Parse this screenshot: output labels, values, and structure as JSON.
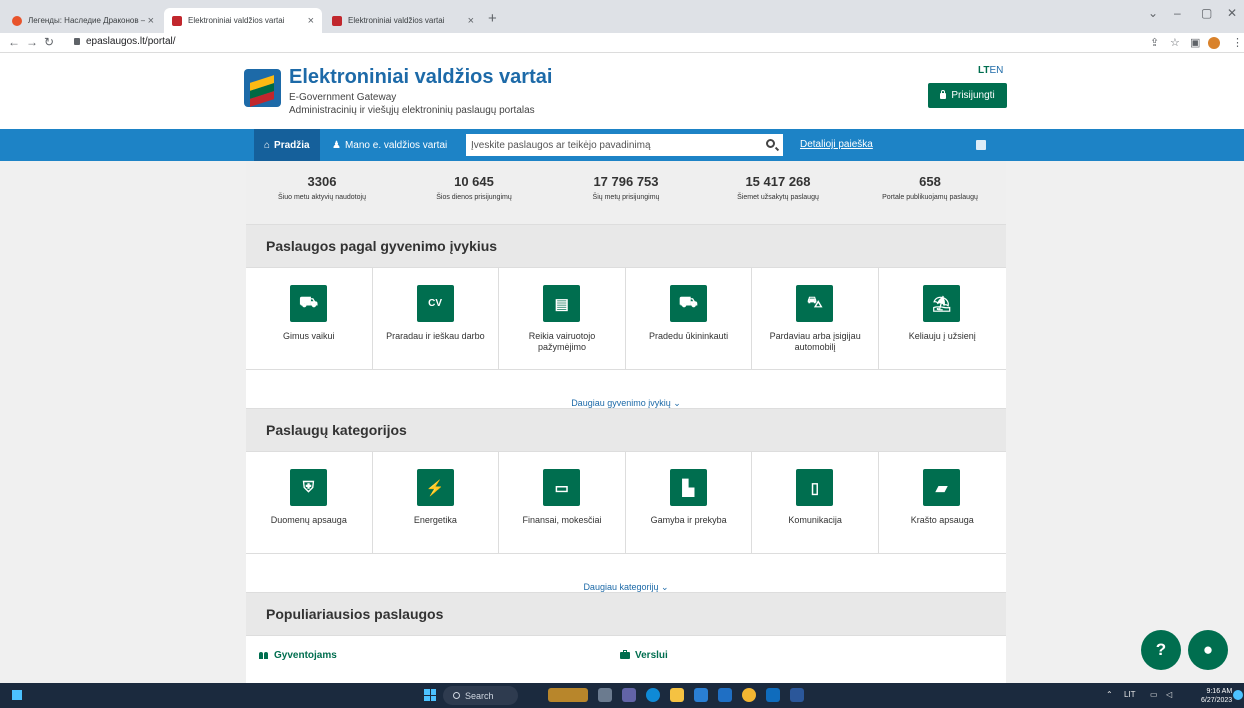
{
  "browser": {
    "tabs": [
      {
        "label": "Легенды: Наследие Драконов – ",
        "active": false,
        "favicon_color": "#e8532b"
      },
      {
        "label": "Elektroniniai valdžios vartai",
        "active": true,
        "favicon_color": "#c1272d"
      },
      {
        "label": "Elektroniniai valdžios vartai",
        "active": false,
        "favicon_color": "#c1272d"
      }
    ],
    "tab_close_glyph": "×",
    "new_tab_glyph": "+",
    "url": "epaslaugos.lt/portal/"
  },
  "header": {
    "title": "Elektroniniai valdžios vartai",
    "subtitle": "E-Government Gateway",
    "tagline": "Administracinių ir viešųjų elektroninių paslaugų portalas",
    "lang_lt": "LT",
    "lang_en": "EN",
    "login_label": "Prisijungti"
  },
  "nav": {
    "home_label": "Pradžia",
    "mano_label": "Mano e. valdžios vartai",
    "search_placeholder": "Įveskite paslaugos ar teikėjo pavadinimą",
    "detail_search_label": "Detalioji paieška"
  },
  "stats": [
    {
      "value": "3306",
      "label": "Šiuo metu aktyvių naudotojų"
    },
    {
      "value": "10 645",
      "label": "Šios dienos prisijungimų"
    },
    {
      "value": "17 796 753",
      "label": "Šių metų prisijungimų"
    },
    {
      "value": "15 417 268",
      "label": "Šiemet užsakytų paslaugų"
    },
    {
      "value": "658",
      "label": "Portale publikuojamų paslaugų"
    }
  ],
  "life_events": {
    "heading": "Paslaugos pagal gyvenimo įvykius",
    "items": [
      {
        "label": "Gimus vaikui",
        "icon": "stroller-icon",
        "glyph": "⛟"
      },
      {
        "label": "Praradau ir ieškau darbo",
        "icon": "cv-icon",
        "glyph": "CV"
      },
      {
        "label": "Reikia vairuotojo pažymėjimo",
        "icon": "license-icon",
        "glyph": "▤"
      },
      {
        "label": "Pradedu ūkininkauti",
        "icon": "tractor-icon",
        "glyph": "⛟"
      },
      {
        "label": "Pardaviau arba įsigijau automobilį",
        "icon": "car-icon",
        "glyph": "⛍"
      },
      {
        "label": "Keliauju į užsienį",
        "icon": "palm-icon",
        "glyph": "⛱"
      }
    ],
    "more_label": "Daugiau gyvenimo įvykių"
  },
  "categories": {
    "heading": "Paslaugų kategorijos",
    "items": [
      {
        "label": "Duomenų apsauga",
        "icon": "shield-icon",
        "glyph": "⛨"
      },
      {
        "label": "Energetika",
        "icon": "battery-icon",
        "glyph": "⚡"
      },
      {
        "label": "Finansai, mokesčiai",
        "icon": "banknote-icon",
        "glyph": "▭"
      },
      {
        "label": "Gamyba ir prekyba",
        "icon": "factory-icon",
        "glyph": "▙"
      },
      {
        "label": "Komunikacija",
        "icon": "phone-icon",
        "glyph": "▯"
      },
      {
        "label": "Krašto apsauga",
        "icon": "tank-icon",
        "glyph": "▰"
      }
    ],
    "more_label": "Daugiau kategorijų"
  },
  "popular": {
    "heading": "Populiariausios paslaugos",
    "col_residents": "Gyventojams",
    "col_business": "Verslui"
  },
  "taskbar": {
    "search_label": "Search",
    "lang": "LIT",
    "time": "9:16 AM",
    "date": "6/27/2023"
  },
  "colors": {
    "brand_blue": "#1d6aa8",
    "nav_blue": "#1d83c6",
    "brand_green": "#006e4f"
  }
}
